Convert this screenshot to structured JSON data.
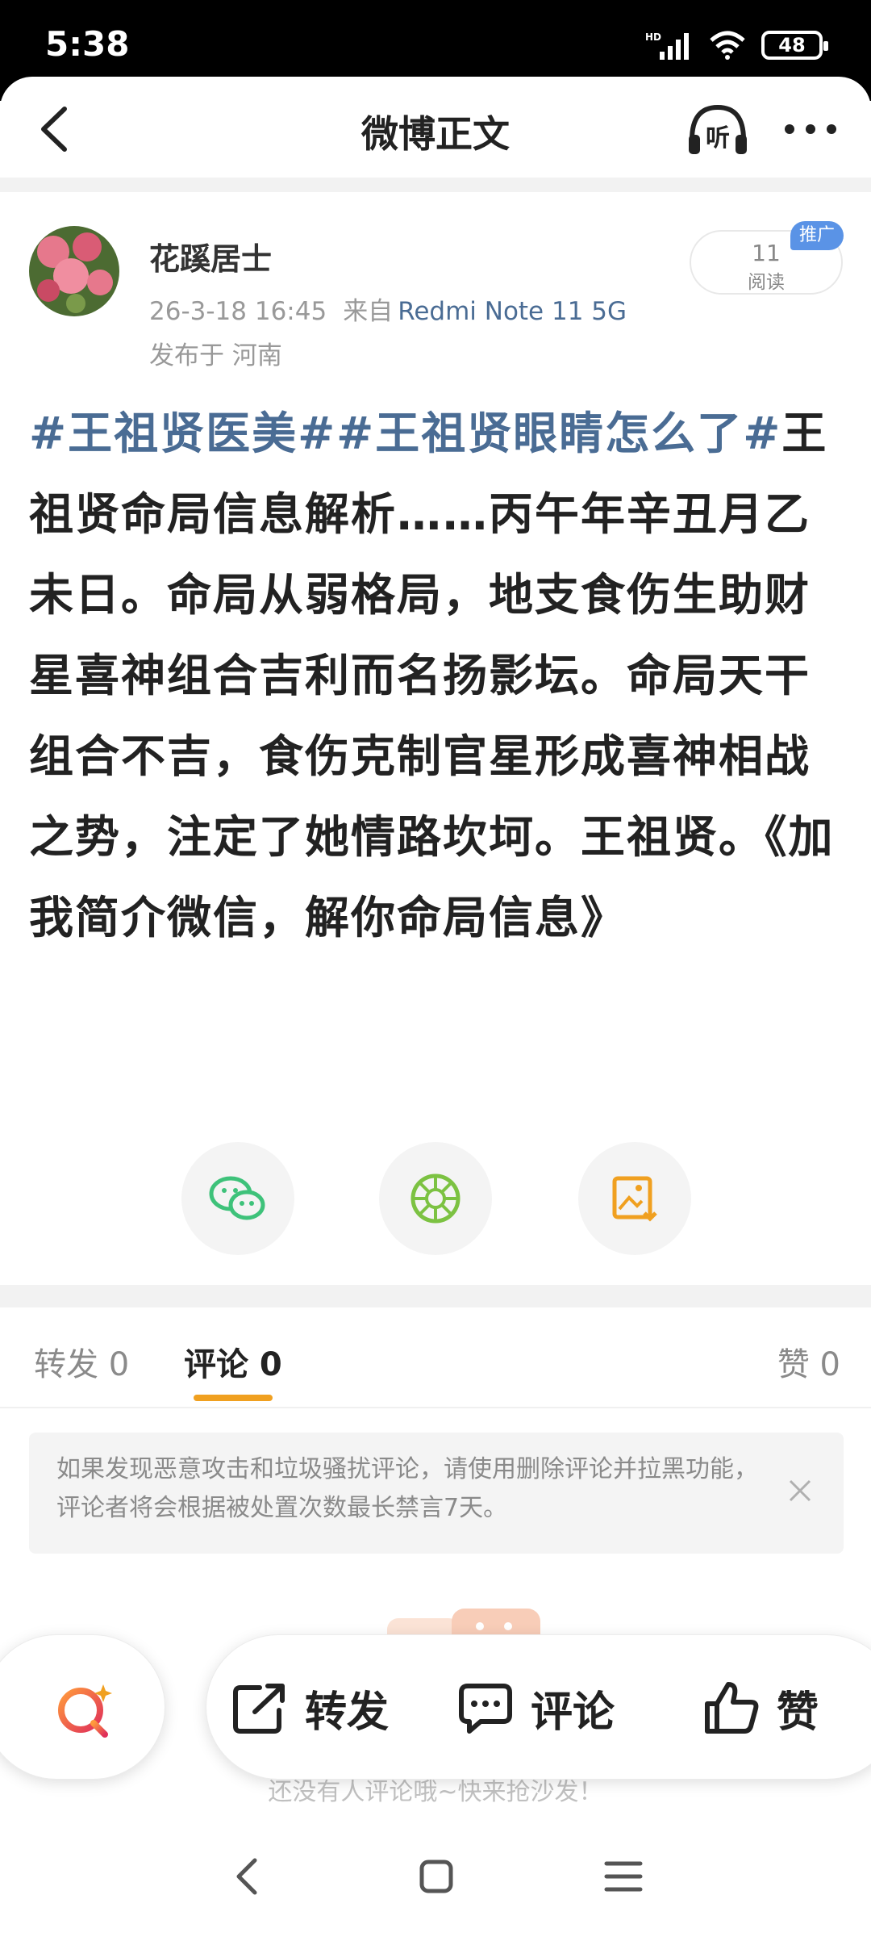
{
  "status_bar": {
    "time": "5:38",
    "battery": "48",
    "network": "HD"
  },
  "header": {
    "title": "微博正文",
    "back_icon": "chevron-left-icon",
    "listen_label": "听",
    "more_icon": "more-dots-icon"
  },
  "author": {
    "name": "花蹊居士",
    "timestamp": "26-3-18 16:45",
    "from_label": "来自",
    "device": "Redmi Note 11 5G",
    "location": "发布于 河南",
    "read_count": "11",
    "read_label": "阅读",
    "promo_badge": "推广"
  },
  "post": {
    "tags": [
      "#王祖贤医美#",
      "#王祖贤眼睛怎么了#"
    ],
    "text": "王祖贤命局信息解析……丙午年辛丑月乙未日。命局从弱格局，地支食伤生助财星喜神组合吉利而名扬影坛。命局天干组合不吉，食伤克制官星形成喜神相战之势，注定了她情路坎坷。王祖贤。《加我简介微信，解你命局信息》"
  },
  "share": [
    {
      "icon": "wechat-icon",
      "color": "#3ec27a"
    },
    {
      "icon": "moments-icon",
      "color": "#7cc242"
    },
    {
      "icon": "save-image-icon",
      "color": "#f0a020"
    }
  ],
  "tabs": {
    "repost": "转发 0",
    "comment": "评论 0",
    "like": "赞 0"
  },
  "notice": {
    "text": "如果发现恶意攻击和垃圾骚扰评论，请使用删除评论并拉黑功能，评论者将会根据被处置次数最长禁言7天。"
  },
  "empty": {
    "text": "还没有人评论哦~快来抢沙发！"
  },
  "actions": {
    "repost": "转发",
    "comment": "评论",
    "like": "赞"
  },
  "colors": {
    "accent": "#f0a020",
    "link": "#4a6c94"
  }
}
